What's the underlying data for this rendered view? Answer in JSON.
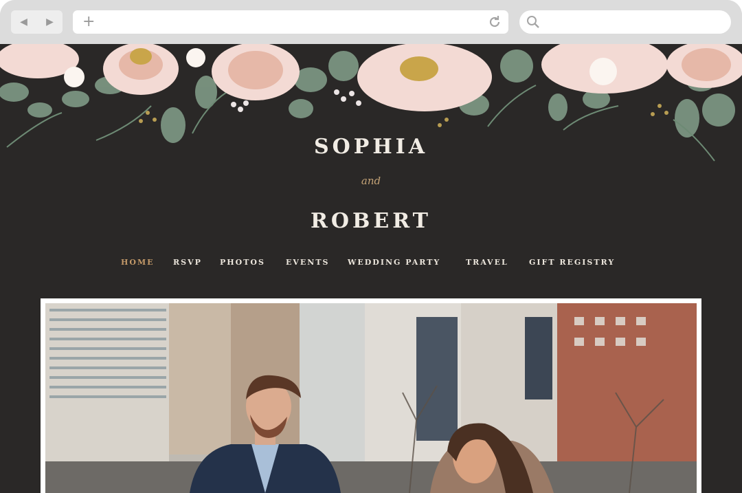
{
  "browser": {
    "back_icon": "back-arrow-icon",
    "forward_icon": "forward-arrow-icon",
    "new_tab_icon": "plus-icon",
    "reload_icon": "reload-icon",
    "search_icon": "search-icon",
    "url_value": "",
    "search_value": ""
  },
  "site": {
    "name_one": "SOPHIA",
    "conjunction": "and",
    "name_two": "ROBERT",
    "accent_color": "#c49a69",
    "background_color": "#2a2827"
  },
  "nav": {
    "items": [
      {
        "label": "HOME",
        "active": true
      },
      {
        "label": "RSVP",
        "active": false
      },
      {
        "label": "PHOTOS",
        "active": false
      },
      {
        "label": "EVENTS",
        "active": false
      },
      {
        "label": "WEDDING PARTY",
        "active": false
      },
      {
        "label": "TRAVEL",
        "active": false
      },
      {
        "label": "GIFT REGISTRY",
        "active": false
      }
    ]
  },
  "hero": {
    "description": "engagement photo of couple in front of city buildings"
  }
}
